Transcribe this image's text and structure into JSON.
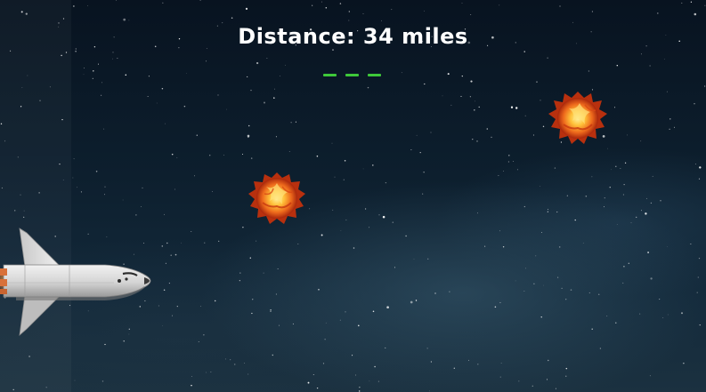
{
  "hud": {
    "distance_text": "Distance: 34 miles",
    "lives_remaining": 3,
    "lives_color": "#3ec93a"
  },
  "scene": {
    "background": "starry night sky",
    "player": "space-shuttle-icon",
    "obstacles": [
      "fireball-icon",
      "fireball-icon"
    ]
  },
  "colors": {
    "text": "#ffffff",
    "sky_dark": "#081320",
    "sky_light": "#1b3140",
    "fire_outer": "#e2501a",
    "fire_inner": "#ffd24a"
  }
}
